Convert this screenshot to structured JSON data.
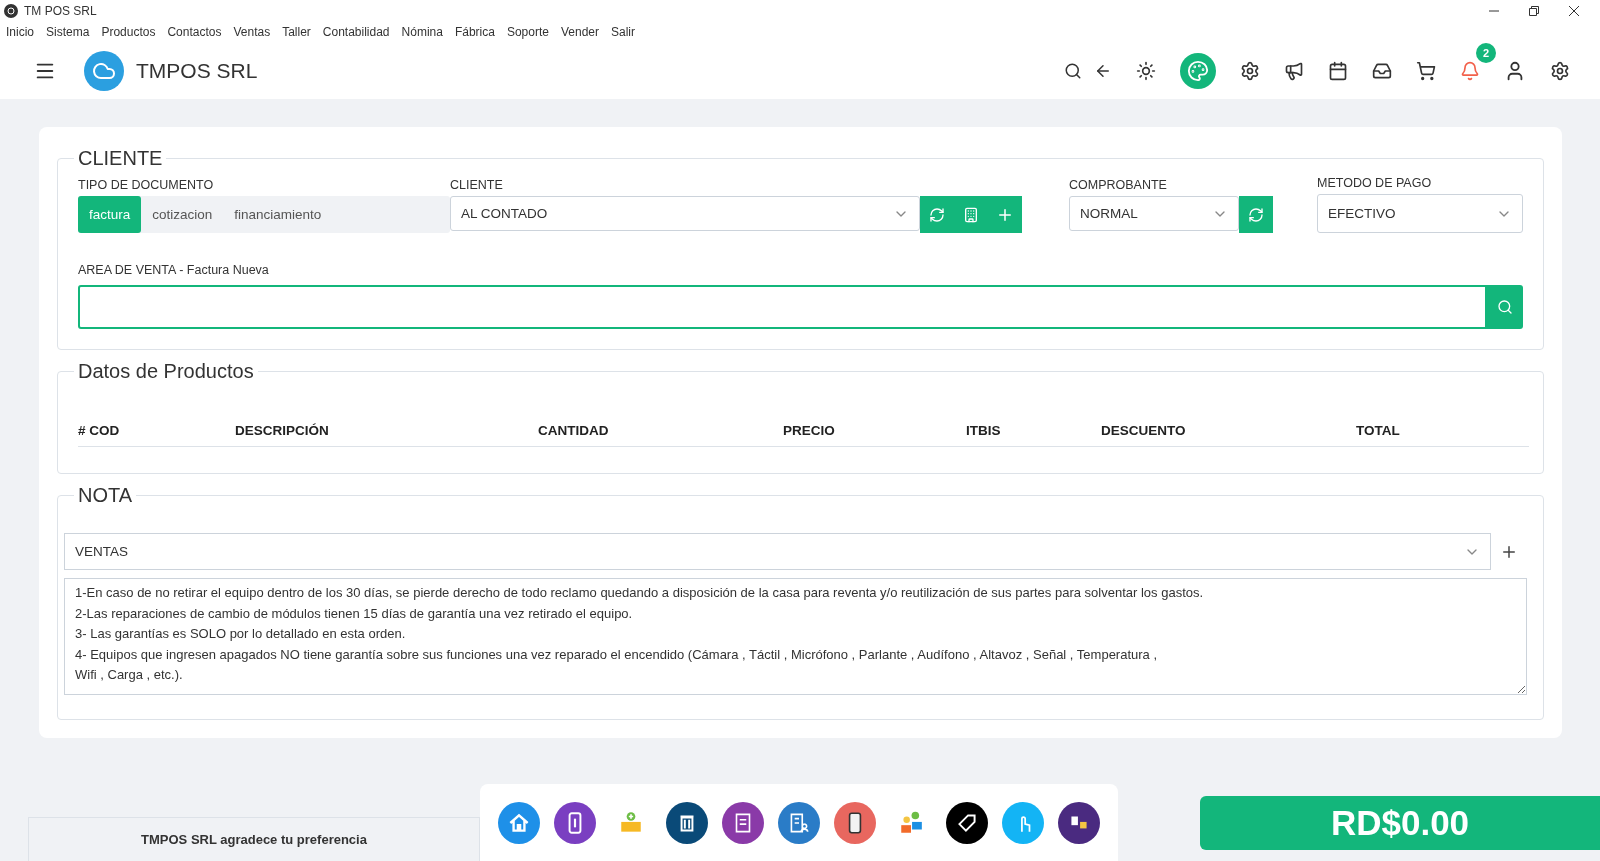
{
  "window": {
    "title": "TM POS SRL"
  },
  "menu": [
    "Inicio",
    "Sistema",
    "Productos",
    "Contactos",
    "Ventas",
    "Taller",
    "Contabilidad",
    "Nómina",
    "Fábrica",
    "Soporte",
    "Vender",
    "Salir"
  ],
  "header": {
    "brand": "TMPOS SRL",
    "notifications": "2"
  },
  "cliente_section": {
    "legend": "CLIENTE",
    "tipo_documento": {
      "label": "TIPO DE DOCUMENTO",
      "options": [
        {
          "label": "factura",
          "selected": true
        },
        {
          "label": "cotizacion",
          "selected": false
        },
        {
          "label": "financiamiento",
          "selected": false
        }
      ]
    },
    "cliente": {
      "label": "CLIENTE",
      "value": "AL CONTADO"
    },
    "comprobante": {
      "label": "COMPROBANTE",
      "value": "NORMAL"
    },
    "metodo_pago": {
      "label": "METODO DE PAGO",
      "value": "EFECTIVO"
    },
    "area_venta": {
      "label": "AREA DE VENTA - Factura Nueva"
    }
  },
  "productos": {
    "legend": "Datos de Productos",
    "columns": [
      "# COD",
      "DESCRIPCIÓN",
      "CANTIDAD",
      "PRECIO",
      "ITBIS",
      "DESCUENTO",
      "TOTAL"
    ]
  },
  "nota": {
    "legend": "NOTA",
    "category": "VENTAS",
    "text": "1-En caso de no retirar el equipo dentro de los 30 días, se pierde derecho de todo reclamo quedando a disposición de la casa para reventa y/o reutilización de sus partes para solventar los gastos.\n2-Las reparaciones de cambio de módulos tienen 15 días de garantía una vez retirado el equipo.\n3- Las garantías es SOLO por lo detallado en esta orden.\n4- Equipos que ingresen apagados NO tiene garantía sobre sus funciones una vez reparado el encendido (Cámara , Táctil , Micrófono , Parlante , Audífono , Altavoz , Señal , Temperatura ,\nWifi , Carga , etc.)."
  },
  "footer": {
    "message": "TMPOS SRL agradece tu preferencia",
    "total": "RD$0.00"
  }
}
